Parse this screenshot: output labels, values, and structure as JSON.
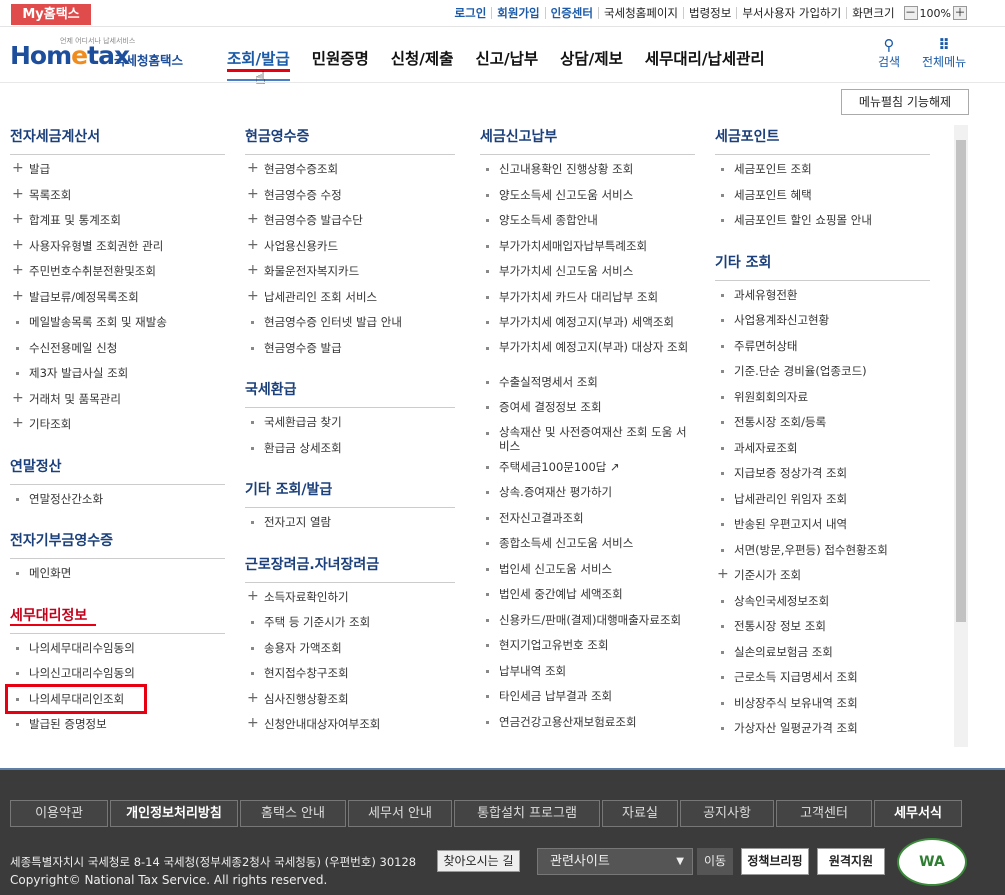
{
  "topbar": {
    "my_home": "My홈택스",
    "links": [
      "로그인",
      "회원가입",
      "인증센터",
      "국세청홈페이지",
      "법령정보",
      "부서사용자 가입하기",
      "화면크기"
    ],
    "zoom": "100%",
    "zoom_minus": "－",
    "zoom_plus": "＋"
  },
  "header": {
    "logo_small": "언제 어디서나 납세서비스",
    "logo_main_a": "Hom",
    "logo_main_b": "e",
    "logo_main_c": "tax",
    "logo_kr": "국세청홈택스",
    "gnb": [
      "조회/발급",
      "민원증명",
      "신청/제출",
      "신고/납부",
      "상담/제보",
      "세무대리/납세관리"
    ],
    "search_label": "검색",
    "allmenu_label": "전체메뉴",
    "search_glyph": "⚲",
    "allmenu_glyph": "⠿"
  },
  "menu_toggle": "메뉴펼침 기능해제",
  "columns": [
    {
      "sections": [
        {
          "title": "전자세금계산서",
          "items": [
            [
              "plus",
              "발급"
            ],
            [
              "plus",
              "목록조회"
            ],
            [
              "plus",
              "합계표 및 통계조회"
            ],
            [
              "plus",
              "사용자유형별 조회권한 관리"
            ],
            [
              "plus",
              "주민번호수취분전환및조회"
            ],
            [
              "plus",
              "발급보류/예정목록조회"
            ],
            [
              "bul",
              "메일발송목록 조회 및 재발송"
            ],
            [
              "bul",
              "수신전용메일 신청"
            ],
            [
              "bul",
              "제3자 발급사실 조회"
            ],
            [
              "plus",
              "거래처 및 품목관리"
            ],
            [
              "plus",
              "기타조회"
            ]
          ]
        },
        {
          "title": "연말정산",
          "items": [
            [
              "bul",
              "연말정산간소화"
            ]
          ]
        },
        {
          "title": "전자기부금영수증",
          "items": [
            [
              "bul",
              "메인화면"
            ]
          ]
        },
        {
          "title": "세무대리정보",
          "items": [
            [
              "bul",
              "나의세무대리수임동의"
            ],
            [
              "bul",
              "나의신고대리수임동의"
            ],
            [
              "bul",
              "나의세무대리인조회"
            ],
            [
              "bul",
              "발급된 증명정보"
            ]
          ]
        }
      ]
    },
    {
      "sections": [
        {
          "title": "현금영수증",
          "items": [
            [
              "plus",
              "현금영수증조회"
            ],
            [
              "plus",
              "현금영수증 수정"
            ],
            [
              "plus",
              "현금영수증 발급수단"
            ],
            [
              "plus",
              "사업용신용카드"
            ],
            [
              "plus",
              "화물운전자복지카드"
            ],
            [
              "plus",
              "납세관리인 조회 서비스"
            ],
            [
              "bul",
              "현금영수증 인터넷 발급 안내"
            ],
            [
              "bul",
              "현금영수증 발급"
            ]
          ]
        },
        {
          "title": "국세환급",
          "items": [
            [
              "bul",
              "국세환급금 찾기"
            ],
            [
              "bul",
              "환급금 상세조회"
            ]
          ]
        },
        {
          "title": "기타 조회/발급",
          "items": [
            [
              "bul",
              "전자고지 열람"
            ]
          ]
        },
        {
          "title": "근로장려금.자녀장려금",
          "items": [
            [
              "plus",
              "소득자료확인하기"
            ],
            [
              "bul",
              "주택 등 기준시가 조회"
            ],
            [
              "bul",
              "송용자 가액조회"
            ],
            [
              "bul",
              "현지접수창구조회"
            ],
            [
              "plus",
              "심사진행상황조회"
            ],
            [
              "plus",
              "신청안내대상자여부조회"
            ]
          ]
        }
      ]
    },
    {
      "sections": [
        {
          "title": "세금신고납부",
          "items": [
            [
              "bul",
              "신고내용확인 진행상황 조회"
            ],
            [
              "bul",
              "양도소득세 신고도움 서비스"
            ],
            [
              "bul",
              "양도소득세 종합안내"
            ],
            [
              "bul",
              "부가가치세매입자납부특례조회"
            ],
            [
              "bul",
              "부가가치세 신고도움 서비스"
            ],
            [
              "bul",
              "부가가치세 카드사 대리납부 조회"
            ],
            [
              "bul",
              "부가가치세 예정고지(부과) 세액조회"
            ],
            [
              "two",
              "부가가치세 예정고지(부과) 대상자 조회"
            ],
            [
              "bul",
              "수출실적명세서 조회"
            ],
            [
              "bul",
              "증여세 결정정보 조회"
            ],
            [
              "two",
              "상속재산 및 사전증여재산 조회 도움 서비스"
            ],
            [
              "bul",
              "주택세금100문100답 ↗"
            ],
            [
              "bul",
              "상속.증여재산 평가하기"
            ],
            [
              "bul",
              "전자신고결과조회"
            ],
            [
              "bul",
              "종합소득세 신고도움 서비스"
            ],
            [
              "bul",
              "법인세 신고도움 서비스"
            ],
            [
              "bul",
              "법인세 중간예납 세액조회"
            ],
            [
              "bul",
              "신용카드/판매(결제)대행매출자료조회"
            ],
            [
              "bul",
              "현지기업고유번호 조회"
            ],
            [
              "bul",
              "납부내역 조회"
            ],
            [
              "bul",
              "타인세금 납부결과 조회"
            ],
            [
              "bul",
              "연금건강고용산재보험료조회"
            ]
          ]
        }
      ]
    },
    {
      "sections": [
        {
          "title": "세금포인트",
          "items": [
            [
              "bul",
              "세금포인트 조회"
            ],
            [
              "bul",
              "세금포인트 혜택"
            ],
            [
              "bul",
              "세금포인트 할인 쇼핑몰 안내"
            ]
          ]
        },
        {
          "title": "기타 조회",
          "items": [
            [
              "bul",
              "과세유형전환"
            ],
            [
              "bul",
              "사업용계좌신고현황"
            ],
            [
              "bul",
              "주류면허상태"
            ],
            [
              "bul",
              "기준.단순 경비율(업종코드)"
            ],
            [
              "bul",
              "위원회회의자료"
            ],
            [
              "bul",
              "전통시장 조회/등록"
            ],
            [
              "bul",
              "과세자료조회"
            ],
            [
              "bul",
              "지급보증 정상가격 조회"
            ],
            [
              "bul",
              "납세관리인 위임자 조회"
            ],
            [
              "bul",
              "반송된 우편고지서 내역"
            ],
            [
              "bul",
              "서면(방문,우편등) 접수현황조회"
            ],
            [
              "plus",
              "기준시가 조회"
            ],
            [
              "bul",
              "상속인국세정보조회"
            ],
            [
              "bul",
              "전통시장 정보 조회"
            ],
            [
              "bul",
              "실손의료보험금 조회"
            ],
            [
              "bul",
              "근로소득 지급명세서 조회"
            ],
            [
              "bul",
              "비상장주식 보유내역 조회"
            ],
            [
              "bul",
              "가상자산 일평균가격 조회"
            ]
          ]
        }
      ]
    }
  ],
  "footer": {
    "nav": [
      "이용약관",
      "개인정보처리방침",
      "홈택스 안내",
      "세무서 안내",
      "통합설치 프로그램",
      "자료실",
      "공지사항",
      "고객센터",
      "세무서식"
    ],
    "address": "세종특별자치시 국세청로 8-14 국세청(정부세종2청사 국세청동) (우편번호) 30128",
    "find_btn": "찾아오시는 길",
    "copyright": "Copyright© National Tax Service. All rights reserved.",
    "related_site": "관련사이트",
    "go_btn": "이동",
    "policy_btn": "정책브리핑",
    "remote_btn": "원격지원",
    "wa_mark": "WA"
  }
}
